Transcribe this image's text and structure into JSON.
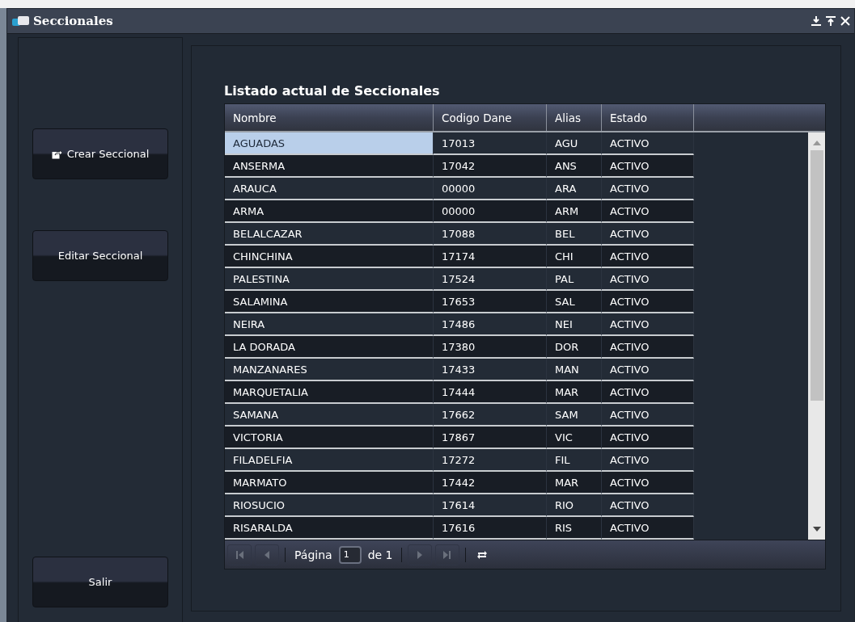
{
  "window": {
    "title": "Seccionales"
  },
  "sidebar": {
    "buttons": [
      {
        "label": "Crear Seccional",
        "kind": "icon"
      },
      {
        "label": "Editar Seccional",
        "kind": "plain"
      }
    ],
    "exit_button": "Salir"
  },
  "table": {
    "title": "Listado actual de Seccionales",
    "columns": [
      "Nombre",
      "Codigo Dane",
      "Alias",
      "Estado"
    ],
    "rows": [
      {
        "cells": [
          "AGUADAS",
          "17013",
          "AGU",
          "ACTIVO"
        ],
        "selected": true
      },
      {
        "cells": [
          "ANSERMA",
          "17042",
          "ANS",
          "ACTIVO"
        ],
        "selected": false
      },
      {
        "cells": [
          "ARAUCA",
          "00000",
          "ARA",
          "ACTIVO"
        ],
        "selected": false
      },
      {
        "cells": [
          "ARMA",
          "00000",
          "ARM",
          "ACTIVO"
        ],
        "selected": false
      },
      {
        "cells": [
          "BELALCAZAR",
          "17088",
          "BEL",
          "ACTIVO"
        ],
        "selected": false
      },
      {
        "cells": [
          "CHINCHINA",
          "17174",
          "CHI",
          "ACTIVO"
        ],
        "selected": false
      },
      {
        "cells": [
          "PALESTINA",
          "17524",
          "PAL",
          "ACTIVO"
        ],
        "selected": false
      },
      {
        "cells": [
          "SALAMINA",
          "17653",
          "SAL",
          "ACTIVO"
        ],
        "selected": false
      },
      {
        "cells": [
          "NEIRA",
          "17486",
          "NEI",
          "ACTIVO"
        ],
        "selected": false
      },
      {
        "cells": [
          "LA DORADA",
          "17380",
          "DOR",
          "ACTIVO"
        ],
        "selected": false
      },
      {
        "cells": [
          "MANZANARES",
          "17433",
          "MAN",
          "ACTIVO"
        ],
        "selected": false
      },
      {
        "cells": [
          "MARQUETALIA",
          "17444",
          "MAR",
          "ACTIVO"
        ],
        "selected": false
      },
      {
        "cells": [
          "SAMANA",
          "17662",
          "SAM",
          "ACTIVO"
        ],
        "selected": false
      },
      {
        "cells": [
          "VICTORIA",
          "17867",
          "VIC",
          "ACTIVO"
        ],
        "selected": false
      },
      {
        "cells": [
          "FILADELFIA",
          "17272",
          "FIL",
          "ACTIVO"
        ],
        "selected": false
      },
      {
        "cells": [
          "MARMATO",
          "17442",
          "MAR",
          "ACTIVO"
        ],
        "selected": false
      },
      {
        "cells": [
          "RIOSUCIO",
          "17614",
          "RIO",
          "ACTIVO"
        ],
        "selected": false
      },
      {
        "cells": [
          "RISARALDA",
          "17616",
          "RIS",
          "ACTIVO"
        ],
        "selected": false
      }
    ]
  },
  "pager": {
    "page_label": "Página",
    "page_value": "1",
    "of_label": "de 1",
    "buttons": [
      {
        "kind": "first",
        "disabled": true
      },
      {
        "kind": "prev",
        "disabled": true
      },
      {
        "kind": "next",
        "disabled": true
      },
      {
        "kind": "last",
        "disabled": true
      }
    ]
  }
}
